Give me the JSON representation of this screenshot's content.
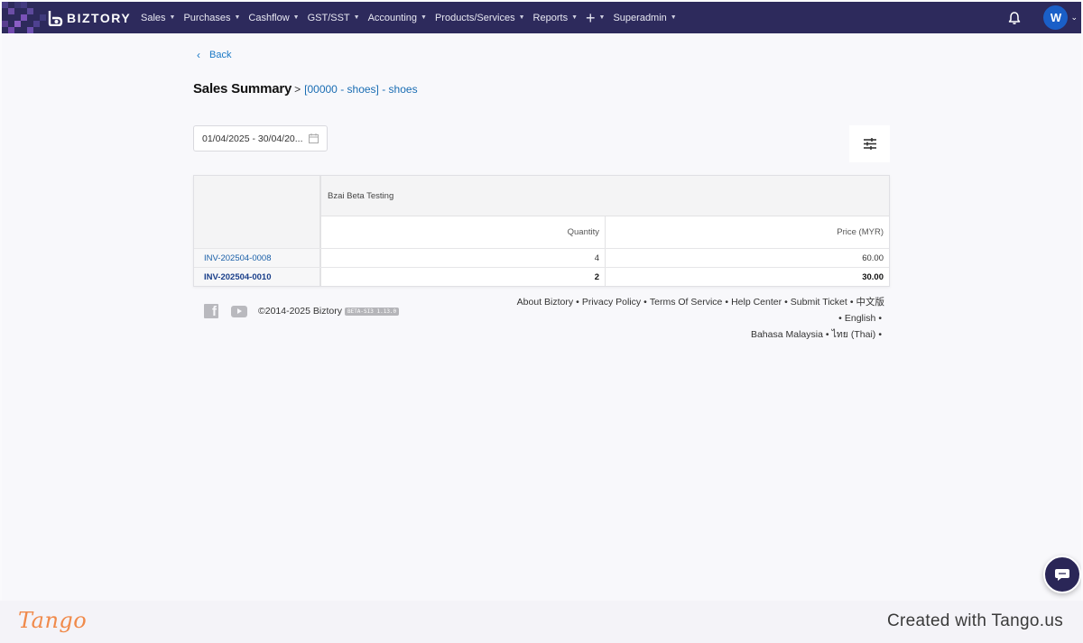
{
  "nav": {
    "brand": "BIZTORY",
    "menu": [
      {
        "label": "Sales"
      },
      {
        "label": "Purchases"
      },
      {
        "label": "Cashflow"
      },
      {
        "label": "GST/SST"
      },
      {
        "label": "Accounting"
      },
      {
        "label": "Products/Services"
      },
      {
        "label": "Reports"
      },
      {
        "label": "+"
      },
      {
        "label": "Superadmin"
      }
    ],
    "avatar_initial": "W",
    "icons": [
      "bell-icon",
      "chevron-down-icon"
    ],
    "colors": {
      "bar": "#2d2a5c",
      "avatar": "#1a5fc8"
    }
  },
  "back_label": "Back",
  "page": {
    "title": "Sales Summary",
    "separator": ">",
    "breadcrumb_link": "[00000 - shoes] - shoes"
  },
  "filters": {
    "date_range": "01/04/2025 - 30/04/20..."
  },
  "table": {
    "group_title": "Bzai Beta Testing",
    "columns": [
      "Quantity",
      "Price (MYR)"
    ],
    "rows": [
      {
        "label": "INV-202504-0008",
        "quantity": "4",
        "price": "60.00"
      },
      {
        "label": "INV-202504-0010",
        "quantity": "2",
        "price": "30.00"
      }
    ]
  },
  "footer": {
    "copyright": "©2014-2025 Biztory",
    "version": "BETA-SI3 1.13.0",
    "links": [
      "About Biztory",
      "Privacy Policy",
      "Terms Of Service",
      "Help Center",
      "Submit Ticket",
      "中文版",
      "English",
      "Bahasa Malaysia",
      "ไทย (Thai)"
    ],
    "bullet": "•"
  },
  "tango": {
    "logo": "Tango",
    "credit": "Created with Tango.us"
  }
}
